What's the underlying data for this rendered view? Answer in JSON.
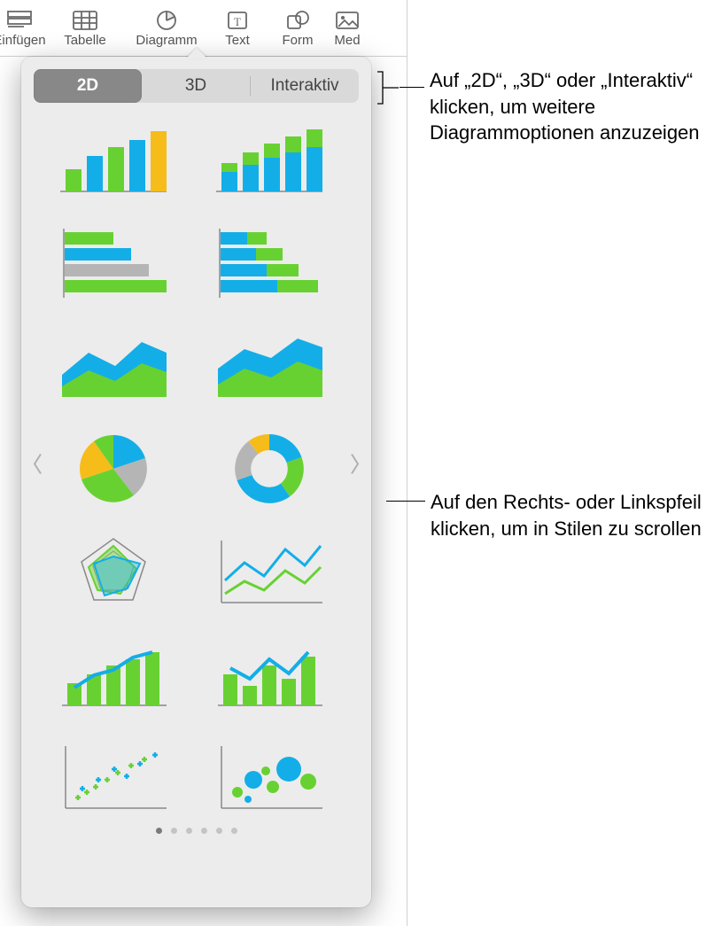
{
  "toolbar": {
    "items": [
      {
        "label": "Einfügen"
      },
      {
        "label": "Tabelle"
      },
      {
        "label": "Diagramm"
      },
      {
        "label": "Text"
      },
      {
        "label": "Form"
      },
      {
        "label": "Medien"
      }
    ]
  },
  "popover": {
    "tabs": {
      "t2d": "2D",
      "t3d": "3D",
      "interactive": "Interaktiv"
    },
    "page_count": 6,
    "active_page": 1
  },
  "callouts": {
    "top": "Auf „2D“, „3D“ oder „Interaktiv“ klicken, um weitere Diagrammoptionen anzuzeigen",
    "arrows": "Auf den Rechts- oder Linkspfeil klicken, um in Stilen zu scrollen"
  },
  "colors": {
    "green": "#68d132",
    "blue": "#13aee7",
    "yellow": "#f6bc1a",
    "grey": "#b5b5b5",
    "axis": "#888888"
  }
}
